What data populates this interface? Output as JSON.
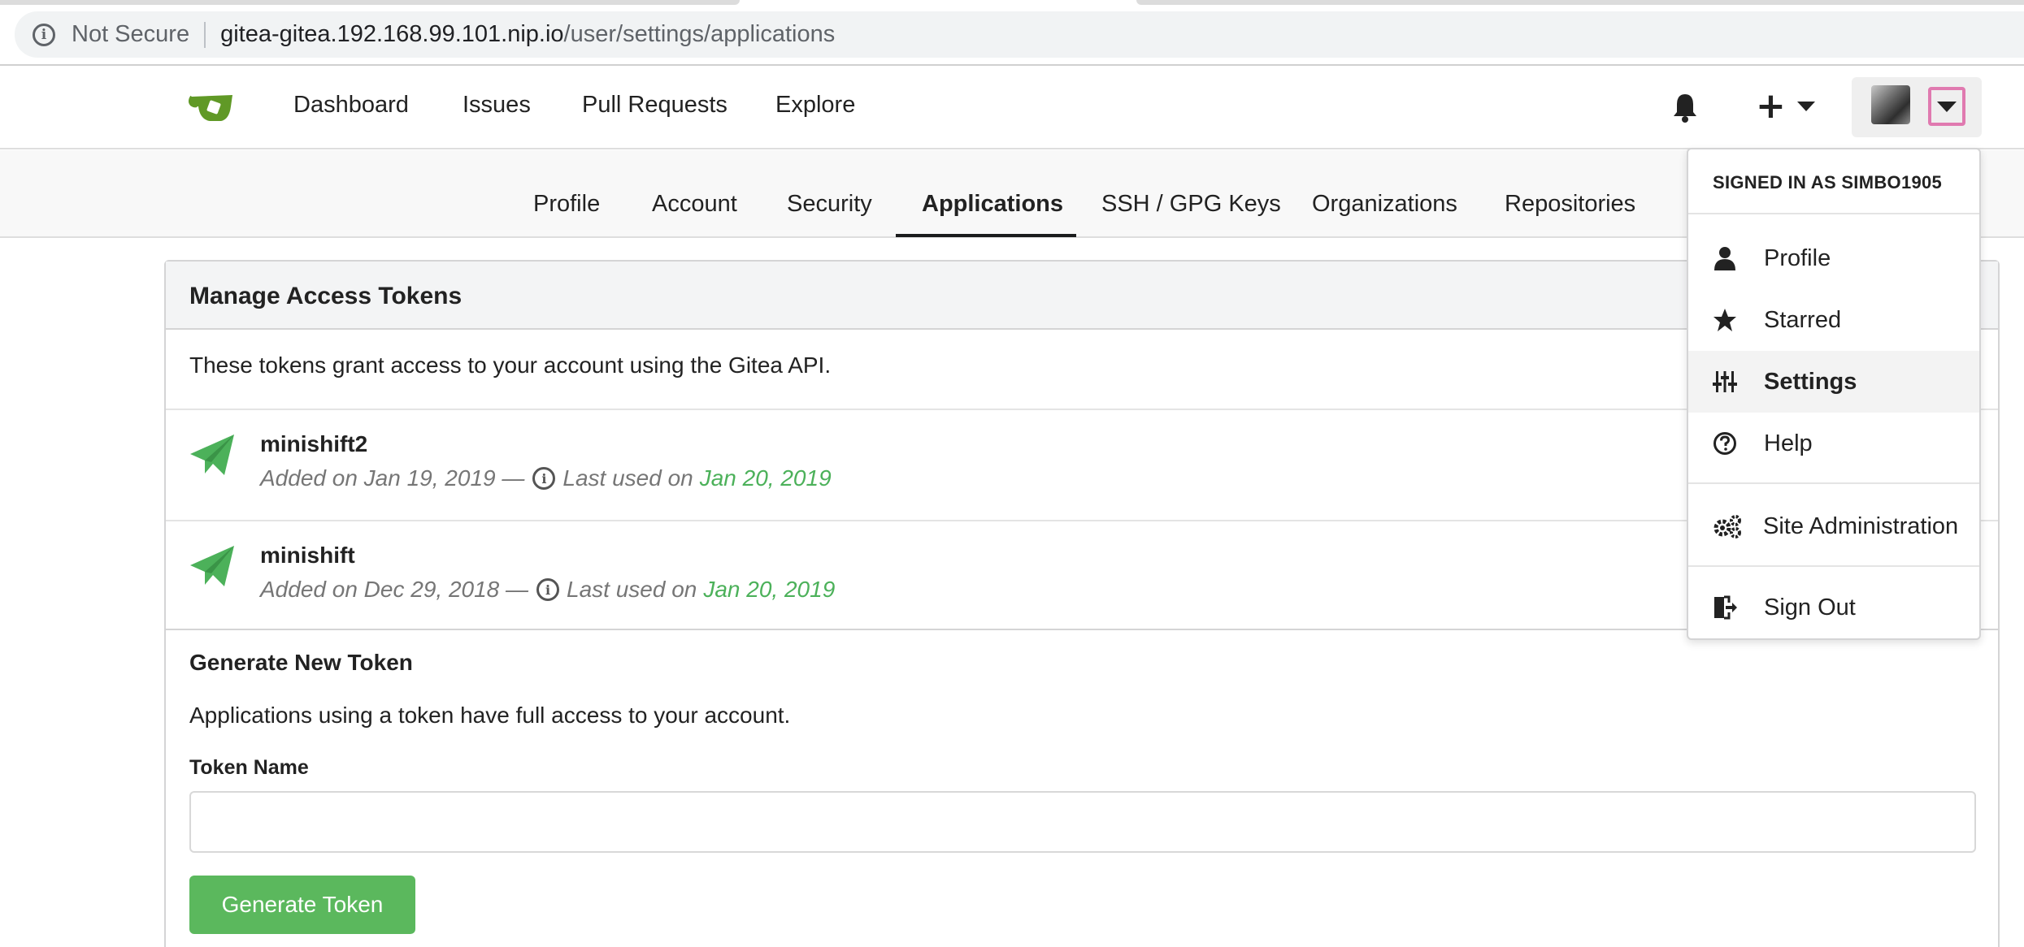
{
  "browser": {
    "security_label": "Not Secure",
    "url_host": "gitea-gitea.192.168.99.101.nip.io",
    "url_path": "/user/settings/applications"
  },
  "navbar": {
    "items": [
      "Dashboard",
      "Issues",
      "Pull Requests",
      "Explore"
    ],
    "logo_icon": "gitea-teacup-icon",
    "notification_icon": "bell-icon",
    "create_icon": "plus-icon"
  },
  "settings_tabs": {
    "items": [
      "Profile",
      "Account",
      "Security",
      "Applications",
      "SSH / GPG Keys",
      "Organizations",
      "Repositories"
    ],
    "active": "Applications"
  },
  "tokens_panel": {
    "title": "Manage Access Tokens",
    "description": "These tokens grant access to your account using the Gitea API.",
    "tokens": [
      {
        "name": "minishift2",
        "added": "Added on Jan 19, 2019 —",
        "last_used_label": "Last used on",
        "last_used_date": "Jan 20, 2019"
      },
      {
        "name": "minishift",
        "added": "Added on Dec 29, 2018 —",
        "last_used_label": "Last used on",
        "last_used_date": "Jan 20, 2019"
      }
    ]
  },
  "generate": {
    "title": "Generate New Token",
    "description": "Applications using a token have full access to your account.",
    "field_label": "Token Name",
    "field_value": "",
    "button_label": "Generate Token"
  },
  "user_dropdown": {
    "header": "SIGNED IN AS SIMBO1905",
    "items": [
      "Profile",
      "Starred",
      "Settings",
      "Help",
      "Site Administration",
      "Sign Out"
    ],
    "active": "Settings"
  },
  "colors": {
    "accent_green": "#4cb15a",
    "button_green": "#5bb85d",
    "focus_pink": "#e07ab0"
  }
}
